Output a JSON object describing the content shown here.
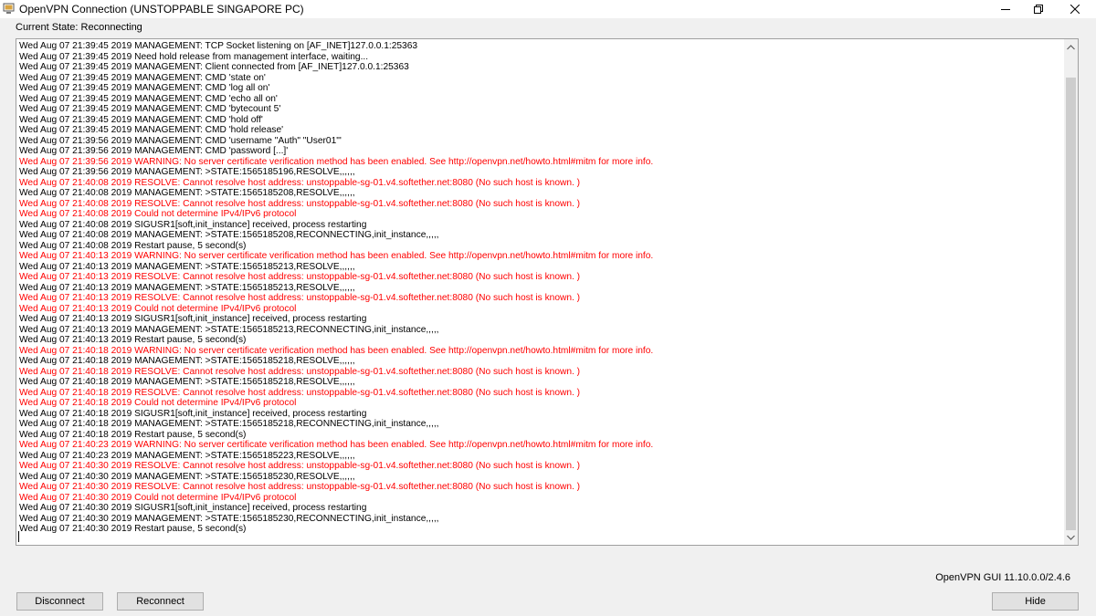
{
  "window": {
    "title": "OpenVPN Connection (UNSTOPPABLE SINGAPORE PC)",
    "icon": "openvpn-monitor-icon"
  },
  "state_label": "Current State: Reconnecting",
  "log_lines": [
    {
      "text": "Wed Aug 07 21:39:45 2019 MANAGEMENT: TCP Socket listening on [AF_INET]127.0.0.1:25363",
      "level": "info"
    },
    {
      "text": "Wed Aug 07 21:39:45 2019 Need hold release from management interface, waiting...",
      "level": "info"
    },
    {
      "text": "Wed Aug 07 21:39:45 2019 MANAGEMENT: Client connected from [AF_INET]127.0.0.1:25363",
      "level": "info"
    },
    {
      "text": "Wed Aug 07 21:39:45 2019 MANAGEMENT: CMD 'state on'",
      "level": "info"
    },
    {
      "text": "Wed Aug 07 21:39:45 2019 MANAGEMENT: CMD 'log all on'",
      "level": "info"
    },
    {
      "text": "Wed Aug 07 21:39:45 2019 MANAGEMENT: CMD 'echo all on'",
      "level": "info"
    },
    {
      "text": "Wed Aug 07 21:39:45 2019 MANAGEMENT: CMD 'bytecount 5'",
      "level": "info"
    },
    {
      "text": "Wed Aug 07 21:39:45 2019 MANAGEMENT: CMD 'hold off'",
      "level": "info"
    },
    {
      "text": "Wed Aug 07 21:39:45 2019 MANAGEMENT: CMD 'hold release'",
      "level": "info"
    },
    {
      "text": "Wed Aug 07 21:39:56 2019 MANAGEMENT: CMD 'username \"Auth\" \"User01\"'",
      "level": "info"
    },
    {
      "text": "Wed Aug 07 21:39:56 2019 MANAGEMENT: CMD 'password [...]'",
      "level": "info"
    },
    {
      "text": "Wed Aug 07 21:39:56 2019 WARNING: No server certificate verification method has been enabled.  See http://openvpn.net/howto.html#mitm for more info.",
      "level": "warn"
    },
    {
      "text": "Wed Aug 07 21:39:56 2019 MANAGEMENT: >STATE:1565185196,RESOLVE,,,,,,",
      "level": "info"
    },
    {
      "text": "Wed Aug 07 21:40:08 2019 RESOLVE: Cannot resolve host address: unstoppable-sg-01.v4.softether.net:8080 (No such host is known. )",
      "level": "warn"
    },
    {
      "text": "Wed Aug 07 21:40:08 2019 MANAGEMENT: >STATE:1565185208,RESOLVE,,,,,,",
      "level": "info"
    },
    {
      "text": "Wed Aug 07 21:40:08 2019 RESOLVE: Cannot resolve host address: unstoppable-sg-01.v4.softether.net:8080 (No such host is known. )",
      "level": "warn"
    },
    {
      "text": "Wed Aug 07 21:40:08 2019 Could not determine IPv4/IPv6 protocol",
      "level": "warn"
    },
    {
      "text": "Wed Aug 07 21:40:08 2019 SIGUSR1[soft,init_instance] received, process restarting",
      "level": "info"
    },
    {
      "text": "Wed Aug 07 21:40:08 2019 MANAGEMENT: >STATE:1565185208,RECONNECTING,init_instance,,,,,",
      "level": "info"
    },
    {
      "text": "Wed Aug 07 21:40:08 2019 Restart pause, 5 second(s)",
      "level": "info"
    },
    {
      "text": "Wed Aug 07 21:40:13 2019 WARNING: No server certificate verification method has been enabled.  See http://openvpn.net/howto.html#mitm for more info.",
      "level": "warn"
    },
    {
      "text": "Wed Aug 07 21:40:13 2019 MANAGEMENT: >STATE:1565185213,RESOLVE,,,,,,",
      "level": "info"
    },
    {
      "text": "Wed Aug 07 21:40:13 2019 RESOLVE: Cannot resolve host address: unstoppable-sg-01.v4.softether.net:8080 (No such host is known. )",
      "level": "warn"
    },
    {
      "text": "Wed Aug 07 21:40:13 2019 MANAGEMENT: >STATE:1565185213,RESOLVE,,,,,,",
      "level": "info"
    },
    {
      "text": "Wed Aug 07 21:40:13 2019 RESOLVE: Cannot resolve host address: unstoppable-sg-01.v4.softether.net:8080 (No such host is known. )",
      "level": "warn"
    },
    {
      "text": "Wed Aug 07 21:40:13 2019 Could not determine IPv4/IPv6 protocol",
      "level": "warn"
    },
    {
      "text": "Wed Aug 07 21:40:13 2019 SIGUSR1[soft,init_instance] received, process restarting",
      "level": "info"
    },
    {
      "text": "Wed Aug 07 21:40:13 2019 MANAGEMENT: >STATE:1565185213,RECONNECTING,init_instance,,,,,",
      "level": "info"
    },
    {
      "text": "Wed Aug 07 21:40:13 2019 Restart pause, 5 second(s)",
      "level": "info"
    },
    {
      "text": "Wed Aug 07 21:40:18 2019 WARNING: No server certificate verification method has been enabled.  See http://openvpn.net/howto.html#mitm for more info.",
      "level": "warn"
    },
    {
      "text": "Wed Aug 07 21:40:18 2019 MANAGEMENT: >STATE:1565185218,RESOLVE,,,,,,",
      "level": "info"
    },
    {
      "text": "Wed Aug 07 21:40:18 2019 RESOLVE: Cannot resolve host address: unstoppable-sg-01.v4.softether.net:8080 (No such host is known. )",
      "level": "warn"
    },
    {
      "text": "Wed Aug 07 21:40:18 2019 MANAGEMENT: >STATE:1565185218,RESOLVE,,,,,,",
      "level": "info"
    },
    {
      "text": "Wed Aug 07 21:40:18 2019 RESOLVE: Cannot resolve host address: unstoppable-sg-01.v4.softether.net:8080 (No such host is known. )",
      "level": "warn"
    },
    {
      "text": "Wed Aug 07 21:40:18 2019 Could not determine IPv4/IPv6 protocol",
      "level": "warn"
    },
    {
      "text": "Wed Aug 07 21:40:18 2019 SIGUSR1[soft,init_instance] received, process restarting",
      "level": "info"
    },
    {
      "text": "Wed Aug 07 21:40:18 2019 MANAGEMENT: >STATE:1565185218,RECONNECTING,init_instance,,,,,",
      "level": "info"
    },
    {
      "text": "Wed Aug 07 21:40:18 2019 Restart pause, 5 second(s)",
      "level": "info"
    },
    {
      "text": "Wed Aug 07 21:40:23 2019 WARNING: No server certificate verification method has been enabled.  See http://openvpn.net/howto.html#mitm for more info.",
      "level": "warn"
    },
    {
      "text": "Wed Aug 07 21:40:23 2019 MANAGEMENT: >STATE:1565185223,RESOLVE,,,,,,",
      "level": "info"
    },
    {
      "text": "Wed Aug 07 21:40:30 2019 RESOLVE: Cannot resolve host address: unstoppable-sg-01.v4.softether.net:8080 (No such host is known. )",
      "level": "warn"
    },
    {
      "text": "Wed Aug 07 21:40:30 2019 MANAGEMENT: >STATE:1565185230,RESOLVE,,,,,,",
      "level": "info"
    },
    {
      "text": "Wed Aug 07 21:40:30 2019 RESOLVE: Cannot resolve host address: unstoppable-sg-01.v4.softether.net:8080 (No such host is known. )",
      "level": "warn"
    },
    {
      "text": "Wed Aug 07 21:40:30 2019 Could not determine IPv4/IPv6 protocol",
      "level": "warn"
    },
    {
      "text": "Wed Aug 07 21:40:30 2019 SIGUSR1[soft,init_instance] received, process restarting",
      "level": "info"
    },
    {
      "text": "Wed Aug 07 21:40:30 2019 MANAGEMENT: >STATE:1565185230,RECONNECTING,init_instance,,,,,",
      "level": "info"
    },
    {
      "text": "Wed Aug 07 21:40:30 2019 Restart pause, 5 second(s)",
      "level": "info"
    }
  ],
  "colors": {
    "info": "#000000",
    "warn": "#ff0000"
  },
  "version_label": "OpenVPN GUI 11.10.0.0/2.4.6",
  "buttons": {
    "disconnect": "Disconnect",
    "reconnect": "Reconnect",
    "hide": "Hide"
  },
  "icons": {
    "minimize": "minimize-icon",
    "maximize": "restore-icon",
    "close": "close-icon",
    "scroll_up": "chevron-up-icon",
    "scroll_down": "chevron-down-icon"
  }
}
